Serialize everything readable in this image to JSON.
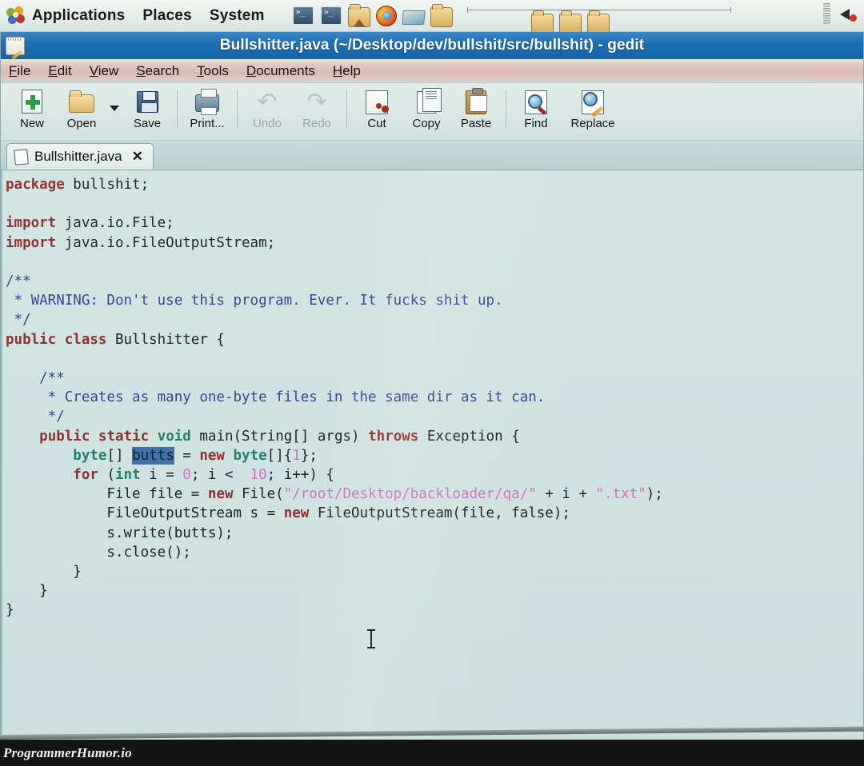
{
  "panel": {
    "menus": [
      "Applications",
      "Places",
      "System"
    ],
    "launchers": [
      {
        "name": "terminal-icon",
        "label": "Terminal"
      },
      {
        "name": "terminal-icon",
        "label": "Terminal"
      },
      {
        "name": "file-manager-icon",
        "label": "Home Folder"
      },
      {
        "name": "firefox-icon",
        "label": "Firefox"
      },
      {
        "name": "dictionary-icon",
        "label": "Dictionary"
      },
      {
        "name": "folder-icon",
        "label": "Folder"
      }
    ],
    "window_list": [
      {
        "name": "folder-window-icon",
        "label": "Folder"
      },
      {
        "name": "folder-window-icon",
        "label": "Folder"
      },
      {
        "name": "folder-window-icon",
        "label": "Folder"
      }
    ],
    "tray": {
      "volume_icon": "speaker-icon"
    }
  },
  "window": {
    "title": "Bullshitter.java (~/Desktop/dev/bullshit/src/bullshit) - gedit",
    "icon": "gedit-icon"
  },
  "menubar": [
    {
      "prefix": "",
      "accel": "F",
      "suffix": "ile"
    },
    {
      "prefix": "",
      "accel": "E",
      "suffix": "dit"
    },
    {
      "prefix": "",
      "accel": "V",
      "suffix": "iew"
    },
    {
      "prefix": "",
      "accel": "S",
      "suffix": "earch"
    },
    {
      "prefix": "",
      "accel": "T",
      "suffix": "ools"
    },
    {
      "prefix": "",
      "accel": "D",
      "suffix": "ocuments"
    },
    {
      "prefix": "",
      "accel": "H",
      "suffix": "elp"
    }
  ],
  "toolbar": {
    "new_label": "New",
    "open_label": "Open",
    "save_label": "Save",
    "print_label": "Print...",
    "undo_label": "Undo",
    "redo_label": "Redo",
    "cut_label": "Cut",
    "copy_label": "Copy",
    "paste_label": "Paste",
    "find_label": "Find",
    "replace_label": "Replace"
  },
  "tabs": [
    {
      "label": "Bullshitter.java",
      "close": "✕",
      "active": true
    }
  ],
  "editor": {
    "selected_text": "butts",
    "language": "java",
    "colors": {
      "background": "#cfe4e2",
      "keyword": "#8c2b2b",
      "type": "#1f7a6b",
      "comment": "#2f3f8f",
      "string": "#d070c0",
      "number": "#d070c0",
      "selection": "#3d6fa6",
      "text": "#1b1b1b"
    },
    "lines": [
      [
        {
          "t": "package",
          "c": "k"
        },
        {
          "t": " bullshit;",
          "c": ""
        }
      ],
      [],
      [
        {
          "t": "import",
          "c": "k"
        },
        {
          "t": " java.io.File;",
          "c": ""
        }
      ],
      [
        {
          "t": "import",
          "c": "k"
        },
        {
          "t": " java.io.FileOutputStream;",
          "c": ""
        }
      ],
      [],
      [
        {
          "t": "/**",
          "c": "cm"
        }
      ],
      [
        {
          "t": " * WARNING: Don't use this program. Ever. It fucks shit up.",
          "c": "cm"
        }
      ],
      [
        {
          "t": " */",
          "c": "cm"
        }
      ],
      [
        {
          "t": "public",
          "c": "k"
        },
        {
          "t": " ",
          "c": ""
        },
        {
          "t": "class",
          "c": "k"
        },
        {
          "t": " Bullshitter {",
          "c": ""
        }
      ],
      [],
      [
        {
          "t": "    /**",
          "c": "cm"
        }
      ],
      [
        {
          "t": "     * Creates as many one-byte files in the same dir as it can.",
          "c": "cm"
        }
      ],
      [
        {
          "t": "     */",
          "c": "cm"
        }
      ],
      [
        {
          "t": "    ",
          "c": ""
        },
        {
          "t": "public",
          "c": "k"
        },
        {
          "t": " ",
          "c": ""
        },
        {
          "t": "static",
          "c": "k"
        },
        {
          "t": " ",
          "c": ""
        },
        {
          "t": "void",
          "c": "kt"
        },
        {
          "t": " main(String[] args) ",
          "c": ""
        },
        {
          "t": "throws",
          "c": "k"
        },
        {
          "t": " Exception {",
          "c": ""
        }
      ],
      [
        {
          "t": "        ",
          "c": ""
        },
        {
          "t": "byte",
          "c": "kt"
        },
        {
          "t": "[] ",
          "c": ""
        },
        {
          "t": "butts",
          "c": "sel"
        },
        {
          "t": " = ",
          "c": ""
        },
        {
          "t": "new",
          "c": "k"
        },
        {
          "t": " ",
          "c": ""
        },
        {
          "t": "byte",
          "c": "kt"
        },
        {
          "t": "[]{",
          "c": ""
        },
        {
          "t": "1",
          "c": "nm"
        },
        {
          "t": "};",
          "c": ""
        }
      ],
      [
        {
          "t": "        ",
          "c": ""
        },
        {
          "t": "for",
          "c": "k"
        },
        {
          "t": " (",
          "c": ""
        },
        {
          "t": "int",
          "c": "kt"
        },
        {
          "t": " i = ",
          "c": ""
        },
        {
          "t": "0",
          "c": "nm"
        },
        {
          "t": "; i <  ",
          "c": ""
        },
        {
          "t": "10",
          "c": "nm"
        },
        {
          "t": "; i++) {",
          "c": ""
        }
      ],
      [
        {
          "t": "            File file = ",
          "c": ""
        },
        {
          "t": "new",
          "c": "k"
        },
        {
          "t": " File(",
          "c": ""
        },
        {
          "t": "\"/root/Desktop/backloader/qa/\"",
          "c": "st"
        },
        {
          "t": " + i + ",
          "c": ""
        },
        {
          "t": "\".txt\"",
          "c": "st"
        },
        {
          "t": ");",
          "c": ""
        }
      ],
      [
        {
          "t": "            FileOutputStream s = ",
          "c": ""
        },
        {
          "t": "new",
          "c": "k"
        },
        {
          "t": " FileOutputStream(file, false);",
          "c": ""
        }
      ],
      [
        {
          "t": "            s.write(butts);",
          "c": ""
        }
      ],
      [
        {
          "t": "            s.close();",
          "c": ""
        }
      ],
      [
        {
          "t": "        }",
          "c": ""
        }
      ],
      [
        {
          "t": "    }",
          "c": ""
        }
      ],
      [
        {
          "t": "}",
          "c": ""
        }
      ]
    ]
  },
  "watermark": {
    "text": "ProgrammerHumor.io"
  }
}
